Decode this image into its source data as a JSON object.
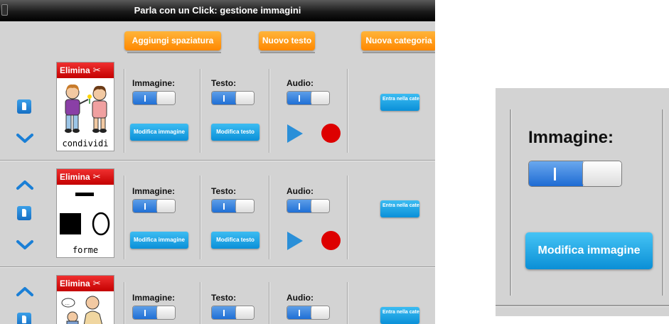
{
  "window": {
    "title": "Parla con un Click: gestione immagini"
  },
  "toolbar": {
    "add_spacing": "Aggiungi spaziatura",
    "new_text": "Nuovo testo",
    "new_category": "Nuova categoria"
  },
  "rows": [
    {
      "delete_label": "Elimina",
      "caption": "condividi",
      "image_label": "Immagine:",
      "text_label": "Testo:",
      "audio_label": "Audio:",
      "edit_image": "Modifica immagine",
      "edit_text": "Modifica testo",
      "enter_category": "Entra nella categoria"
    },
    {
      "delete_label": "Elimina",
      "caption": "forme",
      "image_label": "Immagine:",
      "text_label": "Testo:",
      "audio_label": "Audio:",
      "edit_image": "Modifica immagine",
      "edit_text": "Modifica testo",
      "enter_category": "Entra nella categoria"
    },
    {
      "delete_label": "Elimina",
      "caption": "",
      "image_label": "Immagine:",
      "text_label": "Testo:",
      "audio_label": "Audio:",
      "edit_image": "",
      "edit_text": "",
      "enter_category": "Entra nella categoria"
    }
  ],
  "zoom": {
    "image_label": "Immagine:",
    "edit_image": "Modifica immagine"
  },
  "colors": {
    "orange": "#ff8800",
    "blue": "#0b90d8",
    "red": "#dd0000",
    "panel": "#d3d3d3"
  }
}
